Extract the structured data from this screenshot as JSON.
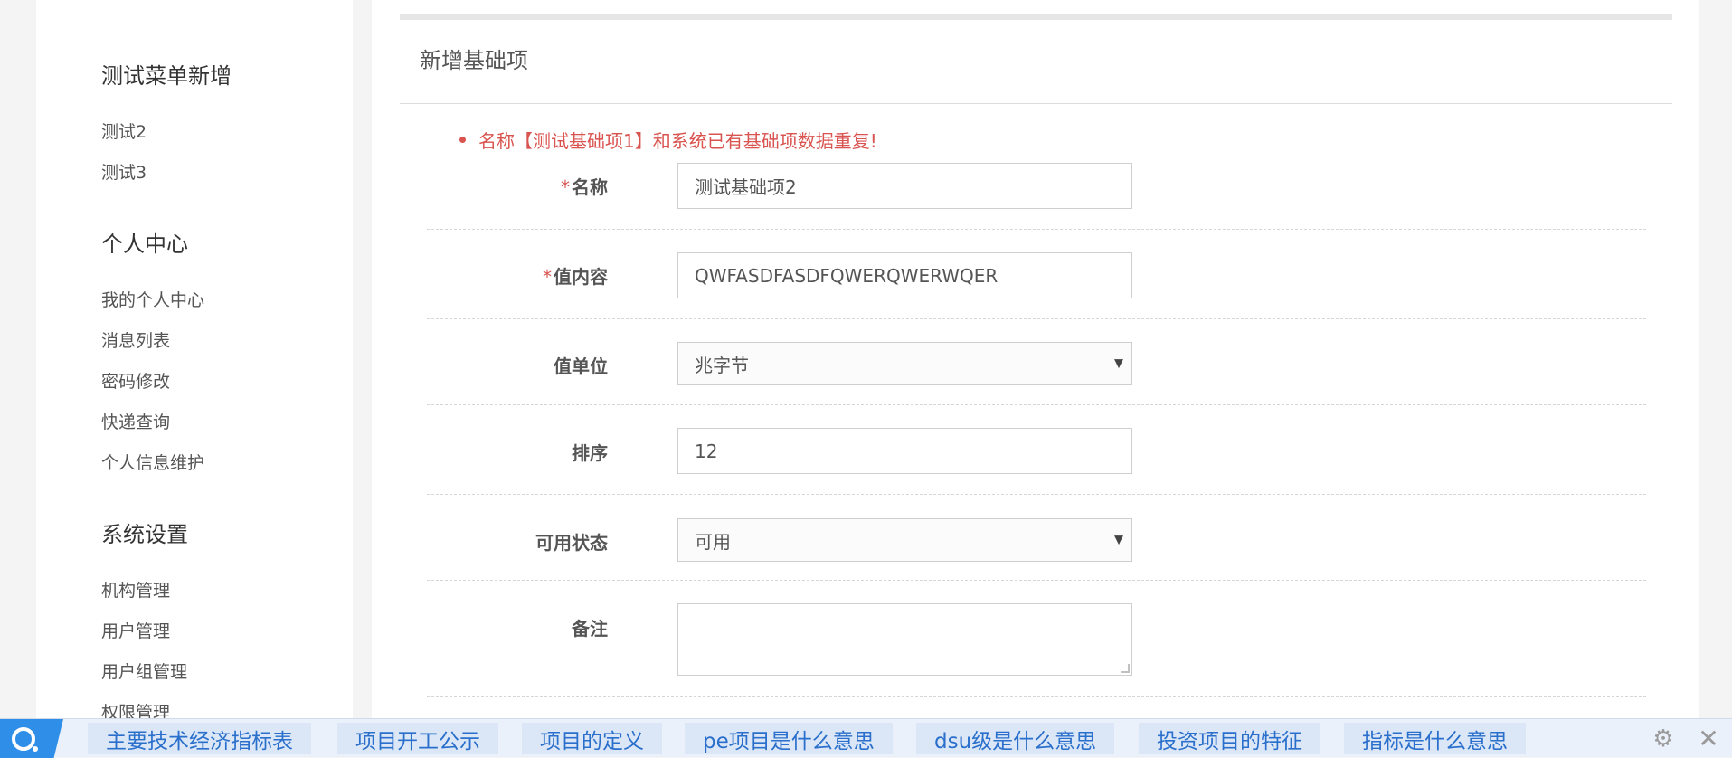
{
  "sidebar": {
    "sections": [
      {
        "title": "测试菜单新增",
        "items": [
          "测试2",
          "测试3"
        ]
      },
      {
        "title": "个人中心",
        "items": [
          "我的个人中心",
          "消息列表",
          "密码修改",
          "快递查询",
          "个人信息维护"
        ]
      },
      {
        "title": "系统设置",
        "items": [
          "机构管理",
          "用户管理",
          "用户组管理",
          "权限管理"
        ]
      }
    ]
  },
  "panel": {
    "title": "新增基础项",
    "error": "名称【测试基础项1】和系统已有基础项数据重复!",
    "required_mark": "*",
    "fields": {
      "name": {
        "label": "名称",
        "value": "测试基础项2",
        "required": true
      },
      "value_content": {
        "label": "值内容",
        "value": "QWFASDFASDFQWERQWERWQER",
        "required": true
      },
      "value_unit": {
        "label": "值单位",
        "value": "兆字节"
      },
      "sort": {
        "label": "排序",
        "value": "12"
      },
      "status": {
        "label": "可用状态",
        "value": "可用"
      },
      "remark": {
        "label": "备注",
        "value": ""
      }
    }
  },
  "bottombar": {
    "links": [
      "主要技术经济指标表",
      "项目开工公示",
      "项目的定义",
      "pe项目是什么意思",
      "dsu级是什么意思",
      "投资项目的特征",
      "指标是什么意思"
    ],
    "icons": {
      "logo": "search-logo-icon",
      "settings": "gear-icon",
      "close": "close-icon"
    }
  },
  "colors": {
    "error": "#d9534f",
    "link": "#2a6fcb",
    "logo": "#2f8fe8"
  }
}
